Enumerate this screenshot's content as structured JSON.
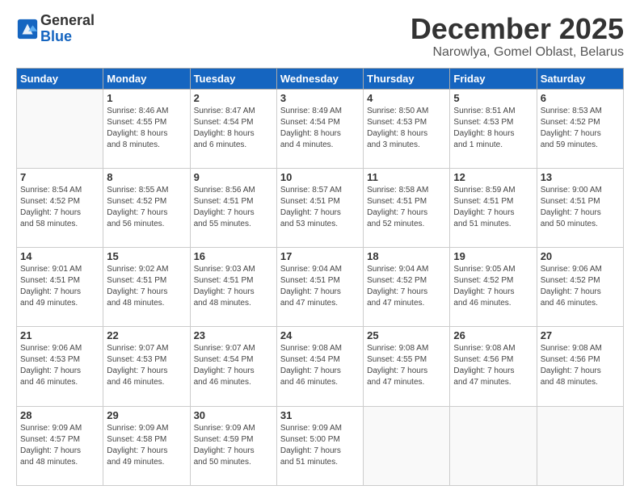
{
  "logo": {
    "general": "General",
    "blue": "Blue"
  },
  "header": {
    "month": "December 2025",
    "location": "Narowlya, Gomel Oblast, Belarus"
  },
  "weekdays": [
    "Sunday",
    "Monday",
    "Tuesday",
    "Wednesday",
    "Thursday",
    "Friday",
    "Saturday"
  ],
  "weeks": [
    [
      {
        "day": "",
        "info": ""
      },
      {
        "day": "1",
        "info": "Sunrise: 8:46 AM\nSunset: 4:55 PM\nDaylight: 8 hours\nand 8 minutes."
      },
      {
        "day": "2",
        "info": "Sunrise: 8:47 AM\nSunset: 4:54 PM\nDaylight: 8 hours\nand 6 minutes."
      },
      {
        "day": "3",
        "info": "Sunrise: 8:49 AM\nSunset: 4:54 PM\nDaylight: 8 hours\nand 4 minutes."
      },
      {
        "day": "4",
        "info": "Sunrise: 8:50 AM\nSunset: 4:53 PM\nDaylight: 8 hours\nand 3 minutes."
      },
      {
        "day": "5",
        "info": "Sunrise: 8:51 AM\nSunset: 4:53 PM\nDaylight: 8 hours\nand 1 minute."
      },
      {
        "day": "6",
        "info": "Sunrise: 8:53 AM\nSunset: 4:52 PM\nDaylight: 7 hours\nand 59 minutes."
      }
    ],
    [
      {
        "day": "7",
        "info": "Sunrise: 8:54 AM\nSunset: 4:52 PM\nDaylight: 7 hours\nand 58 minutes."
      },
      {
        "day": "8",
        "info": "Sunrise: 8:55 AM\nSunset: 4:52 PM\nDaylight: 7 hours\nand 56 minutes."
      },
      {
        "day": "9",
        "info": "Sunrise: 8:56 AM\nSunset: 4:51 PM\nDaylight: 7 hours\nand 55 minutes."
      },
      {
        "day": "10",
        "info": "Sunrise: 8:57 AM\nSunset: 4:51 PM\nDaylight: 7 hours\nand 53 minutes."
      },
      {
        "day": "11",
        "info": "Sunrise: 8:58 AM\nSunset: 4:51 PM\nDaylight: 7 hours\nand 52 minutes."
      },
      {
        "day": "12",
        "info": "Sunrise: 8:59 AM\nSunset: 4:51 PM\nDaylight: 7 hours\nand 51 minutes."
      },
      {
        "day": "13",
        "info": "Sunrise: 9:00 AM\nSunset: 4:51 PM\nDaylight: 7 hours\nand 50 minutes."
      }
    ],
    [
      {
        "day": "14",
        "info": "Sunrise: 9:01 AM\nSunset: 4:51 PM\nDaylight: 7 hours\nand 49 minutes."
      },
      {
        "day": "15",
        "info": "Sunrise: 9:02 AM\nSunset: 4:51 PM\nDaylight: 7 hours\nand 48 minutes."
      },
      {
        "day": "16",
        "info": "Sunrise: 9:03 AM\nSunset: 4:51 PM\nDaylight: 7 hours\nand 48 minutes."
      },
      {
        "day": "17",
        "info": "Sunrise: 9:04 AM\nSunset: 4:51 PM\nDaylight: 7 hours\nand 47 minutes."
      },
      {
        "day": "18",
        "info": "Sunrise: 9:04 AM\nSunset: 4:52 PM\nDaylight: 7 hours\nand 47 minutes."
      },
      {
        "day": "19",
        "info": "Sunrise: 9:05 AM\nSunset: 4:52 PM\nDaylight: 7 hours\nand 46 minutes."
      },
      {
        "day": "20",
        "info": "Sunrise: 9:06 AM\nSunset: 4:52 PM\nDaylight: 7 hours\nand 46 minutes."
      }
    ],
    [
      {
        "day": "21",
        "info": "Sunrise: 9:06 AM\nSunset: 4:53 PM\nDaylight: 7 hours\nand 46 minutes."
      },
      {
        "day": "22",
        "info": "Sunrise: 9:07 AM\nSunset: 4:53 PM\nDaylight: 7 hours\nand 46 minutes."
      },
      {
        "day": "23",
        "info": "Sunrise: 9:07 AM\nSunset: 4:54 PM\nDaylight: 7 hours\nand 46 minutes."
      },
      {
        "day": "24",
        "info": "Sunrise: 9:08 AM\nSunset: 4:54 PM\nDaylight: 7 hours\nand 46 minutes."
      },
      {
        "day": "25",
        "info": "Sunrise: 9:08 AM\nSunset: 4:55 PM\nDaylight: 7 hours\nand 47 minutes."
      },
      {
        "day": "26",
        "info": "Sunrise: 9:08 AM\nSunset: 4:56 PM\nDaylight: 7 hours\nand 47 minutes."
      },
      {
        "day": "27",
        "info": "Sunrise: 9:08 AM\nSunset: 4:56 PM\nDaylight: 7 hours\nand 48 minutes."
      }
    ],
    [
      {
        "day": "28",
        "info": "Sunrise: 9:09 AM\nSunset: 4:57 PM\nDaylight: 7 hours\nand 48 minutes."
      },
      {
        "day": "29",
        "info": "Sunrise: 9:09 AM\nSunset: 4:58 PM\nDaylight: 7 hours\nand 49 minutes."
      },
      {
        "day": "30",
        "info": "Sunrise: 9:09 AM\nSunset: 4:59 PM\nDaylight: 7 hours\nand 50 minutes."
      },
      {
        "day": "31",
        "info": "Sunrise: 9:09 AM\nSunset: 5:00 PM\nDaylight: 7 hours\nand 51 minutes."
      },
      {
        "day": "",
        "info": ""
      },
      {
        "day": "",
        "info": ""
      },
      {
        "day": "",
        "info": ""
      }
    ]
  ]
}
